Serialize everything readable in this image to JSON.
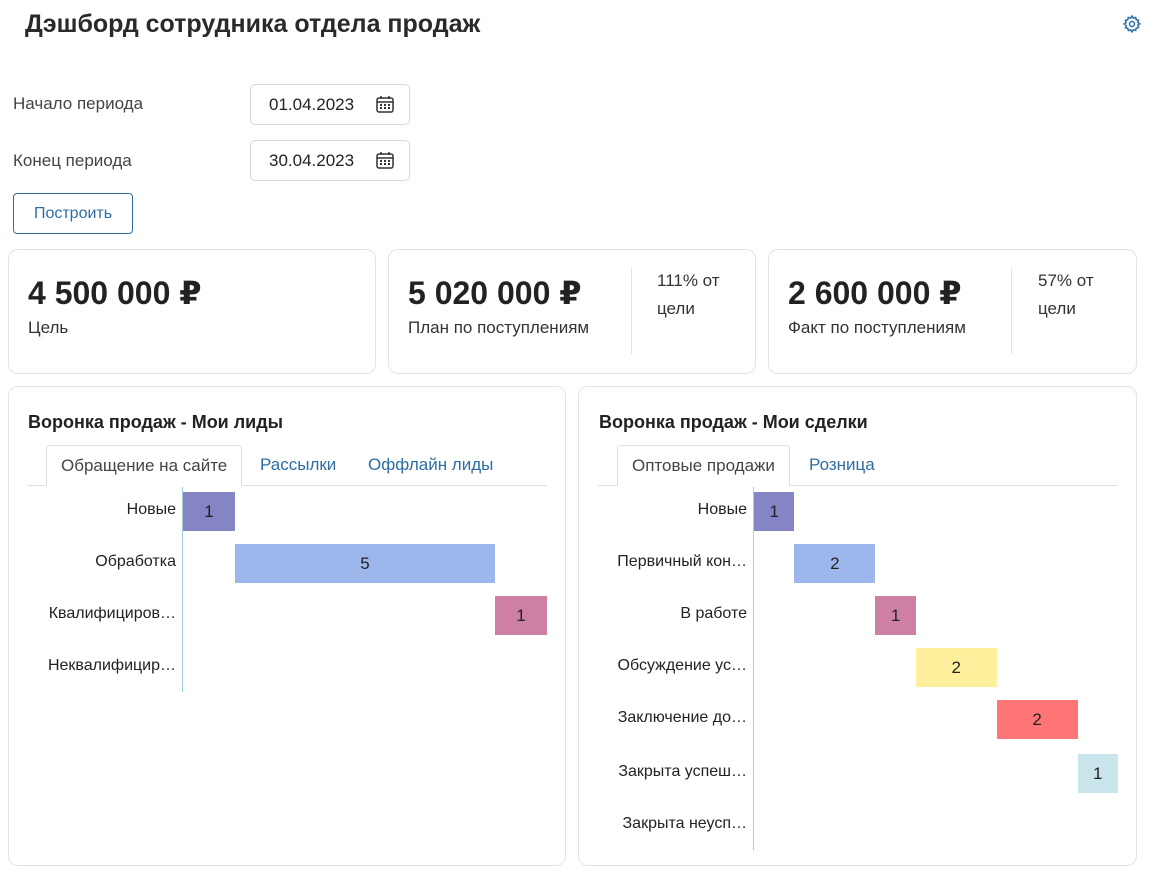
{
  "header": {
    "title": "Дэшборд сотрудника отдела продаж",
    "settings_icon": "gear-icon"
  },
  "filters": {
    "start_label": "Начало периода",
    "start_value": "01.04.2023",
    "end_label": "Конец периода",
    "end_value": "30.04.2023",
    "calendar_icon": "calendar-icon",
    "build_label": "Построить"
  },
  "kpi": [
    {
      "value": "4 500 000 ₽",
      "label": "Цель"
    },
    {
      "value": "5 020 000 ₽",
      "label": "План по поступлениям",
      "pct": "111% от цели"
    },
    {
      "value": "2 600 000 ₽",
      "label": "Факт по поступлениям",
      "pct": "57% от цели"
    }
  ],
  "chart_data": [
    {
      "type": "bar",
      "subtype": "funnel-waterfall",
      "title": "Воронка продаж - Мои лиды",
      "tabs": [
        "Обращение на сайте",
        "Рассылки",
        "Оффлайн лиды"
      ],
      "active_tab": 0,
      "categories": [
        "Новые",
        "Обработка",
        "Квалифициров…",
        "Неквалифицир…"
      ],
      "values": [
        1,
        5,
        1,
        0
      ],
      "colors": [
        "#8584c5",
        "#9db7ec",
        "#cd80a3",
        "#cccccc"
      ]
    },
    {
      "type": "bar",
      "subtype": "funnel-waterfall",
      "title": "Воронка продаж - Мои сделки",
      "tabs": [
        "Оптовые продажи",
        "Розница"
      ],
      "active_tab": 0,
      "categories": [
        "Новые",
        "Первичный кон…",
        "В работе",
        "Обсуждение ус…",
        "Заключение до…",
        "Закрыта успеш…",
        "Закрыта неусп…"
      ],
      "values": [
        1,
        2,
        1,
        2,
        2,
        1,
        0
      ],
      "colors": [
        "#8584c5",
        "#9db7ec",
        "#cd80a3",
        "#fef09d",
        "#ff7474",
        "#c9e4ea",
        "#cccccc"
      ]
    }
  ]
}
